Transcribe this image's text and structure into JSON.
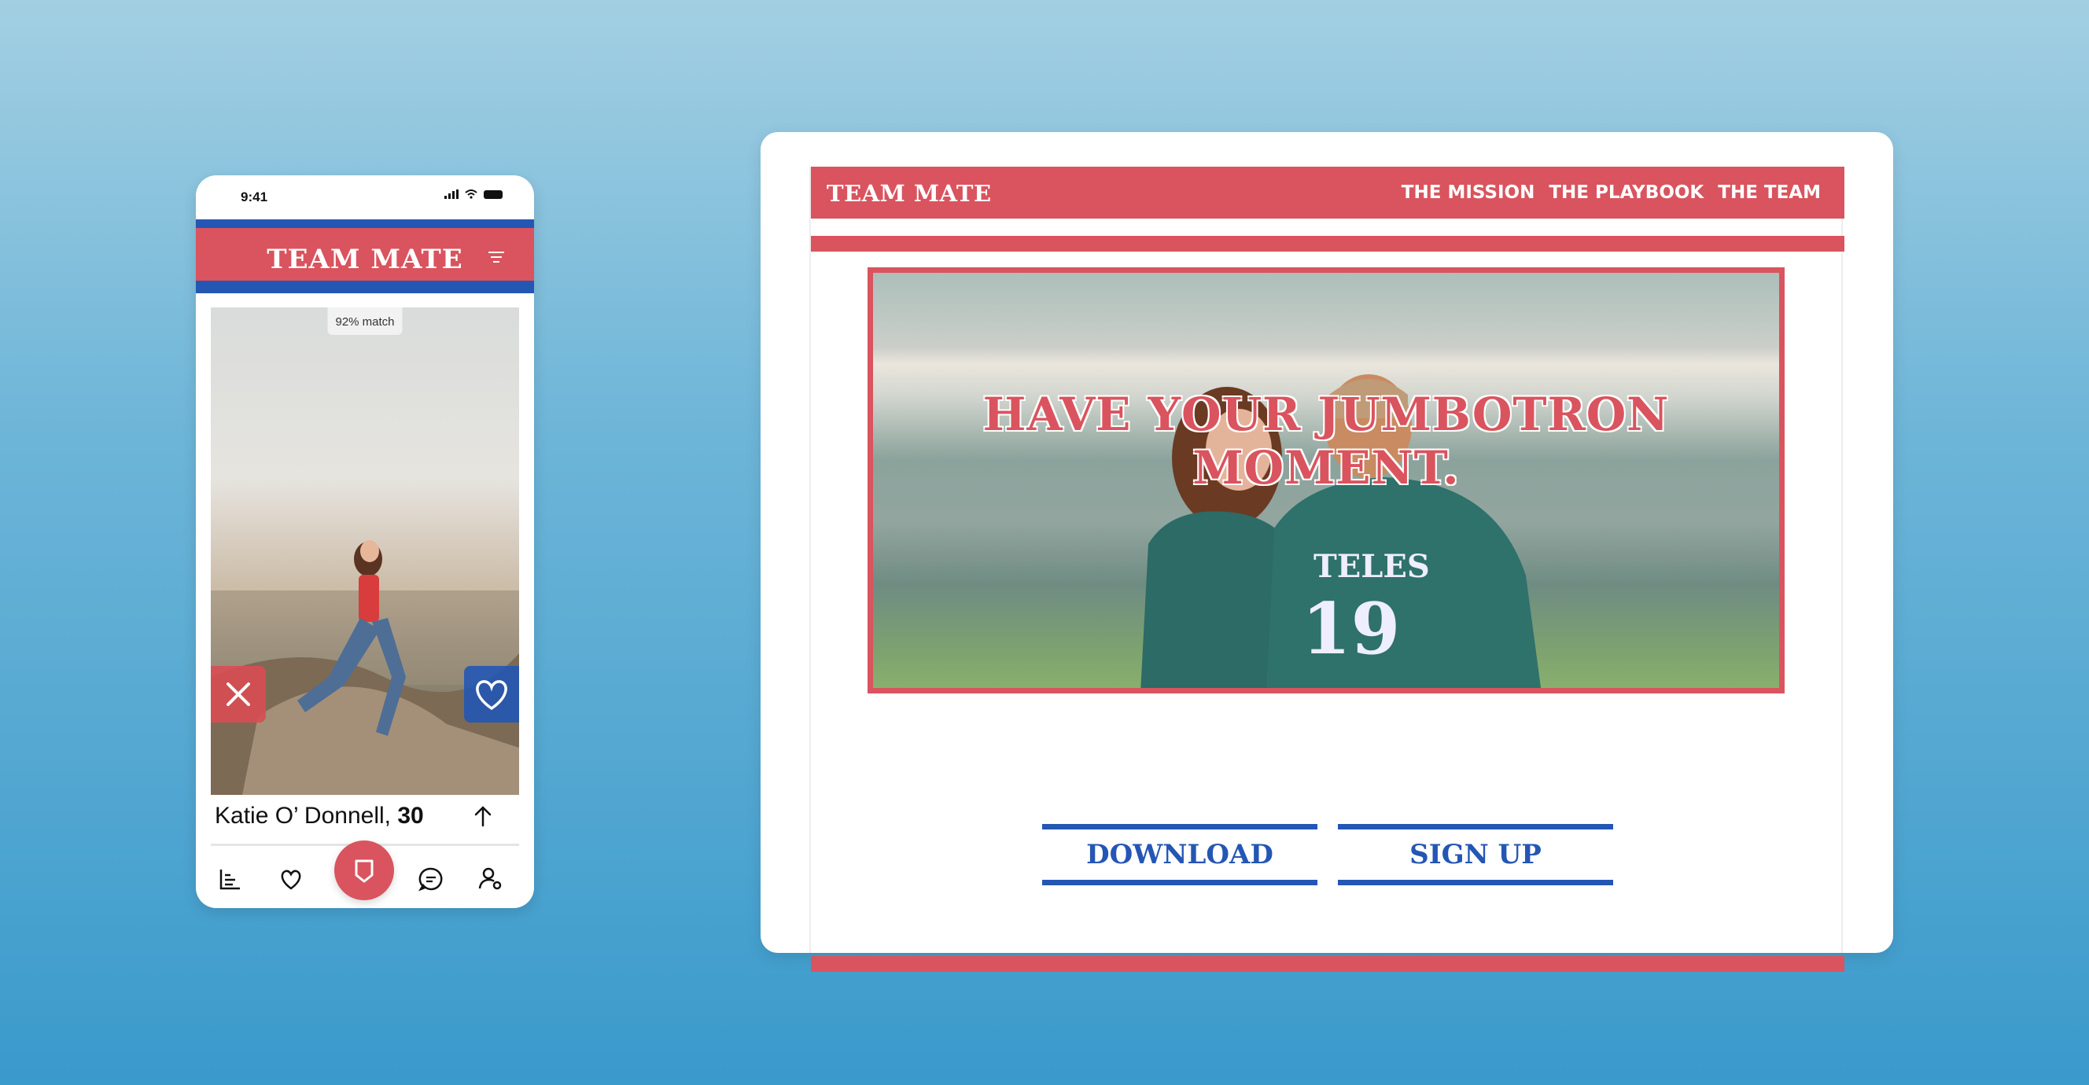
{
  "phone": {
    "status_time": "9:41",
    "app_title": "TEAM MATE",
    "match_badge": "92% match",
    "profile_name": "Katie O’ Donnell,",
    "profile_age": "30",
    "tabs": [
      {
        "name": "stats-icon"
      },
      {
        "name": "heart-icon"
      },
      {
        "name": "home-shield-icon"
      },
      {
        "name": "chat-icon"
      },
      {
        "name": "profile-settings-icon"
      }
    ],
    "colors": {
      "red": "#d9545e",
      "blue": "#2456b4"
    }
  },
  "site": {
    "logo": "TEAM MATE",
    "nav": [
      "THE MISSION",
      "THE PLAYBOOK",
      "THE TEAM"
    ],
    "hero_headline": "HAVE YOUR JUMBOTRON MOMENT.",
    "jersey_name": "TELES",
    "jersey_number": "19",
    "download_label": "DOWNLOAD",
    "signup_label": "SIGN UP"
  }
}
